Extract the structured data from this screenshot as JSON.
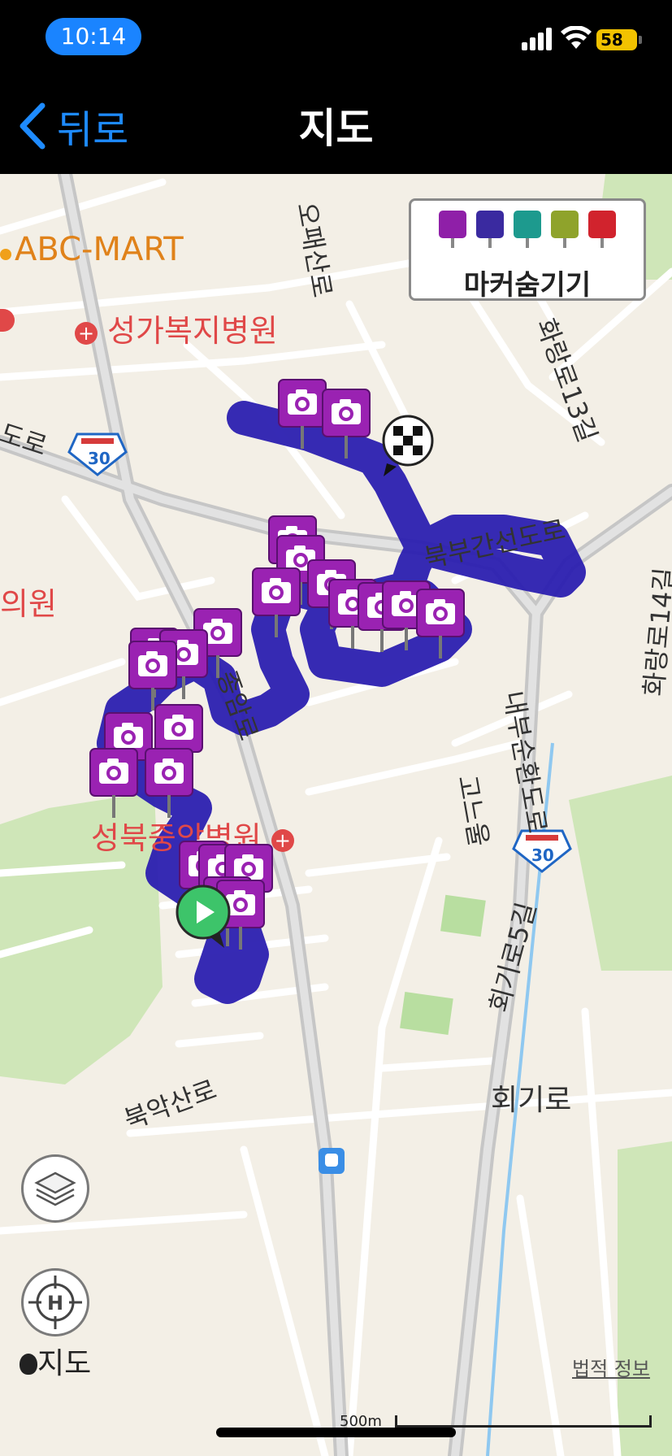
{
  "status": {
    "time": "10:14",
    "battery": "58"
  },
  "nav": {
    "back_label": "뒤로",
    "title": "지도"
  },
  "markers_panel": {
    "label": "마커숨기기",
    "types": [
      {
        "icon": "photo-icon",
        "color": "#8f1fa8"
      },
      {
        "icon": "video-icon",
        "color": "#3a2aa0"
      },
      {
        "icon": "voice-icon",
        "color": "#1d9a8e"
      },
      {
        "icon": "memo-icon",
        "color": "#8fa32b"
      },
      {
        "icon": "flag-icon",
        "color": "#d1232d"
      }
    ]
  },
  "map": {
    "labels": {
      "abc_mart": "ABC-MART",
      "seongga_hospital": "성가복지병원",
      "dolo": "도로",
      "route30_a": "30",
      "route30_b": "30",
      "ouiwon": "의원",
      "opae_road": "오패산로",
      "hwarang": "화랑로13길",
      "bukbu": "북부간선도로",
      "hwarang14": "화랑로14길",
      "jungang": "종암로",
      "naebu": "내부순환도로",
      "gonaeul": "고느울",
      "seongbuk_hospital": "성북중앙병원",
      "hoegi5": "회기로5길",
      "bugak": "북악산로",
      "hoegi": "회기로"
    },
    "attribution": "지도",
    "legal": "법적 정보",
    "scale": "500m"
  },
  "colors": {
    "track": "#2b1fb0",
    "photo_marker": "#9a22b2",
    "start": "#3dc46a",
    "accent": "#1e8bff"
  }
}
